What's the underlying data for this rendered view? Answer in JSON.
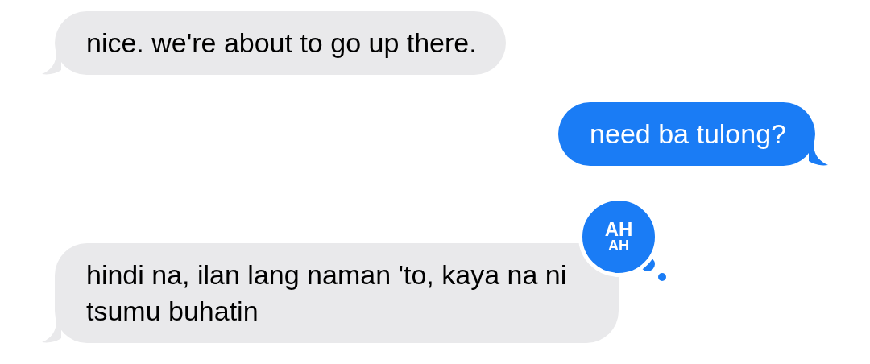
{
  "messages": [
    {
      "kind": "received",
      "text": "nice. we're about to go up there."
    },
    {
      "kind": "sent",
      "text": "need ba tulong?"
    },
    {
      "kind": "received",
      "text": "hindi na, ilan lang naman 'to, kaya na ni tsumu buhatin",
      "tapback": {
        "lines": [
          "AH",
          "AH"
        ]
      }
    }
  ]
}
